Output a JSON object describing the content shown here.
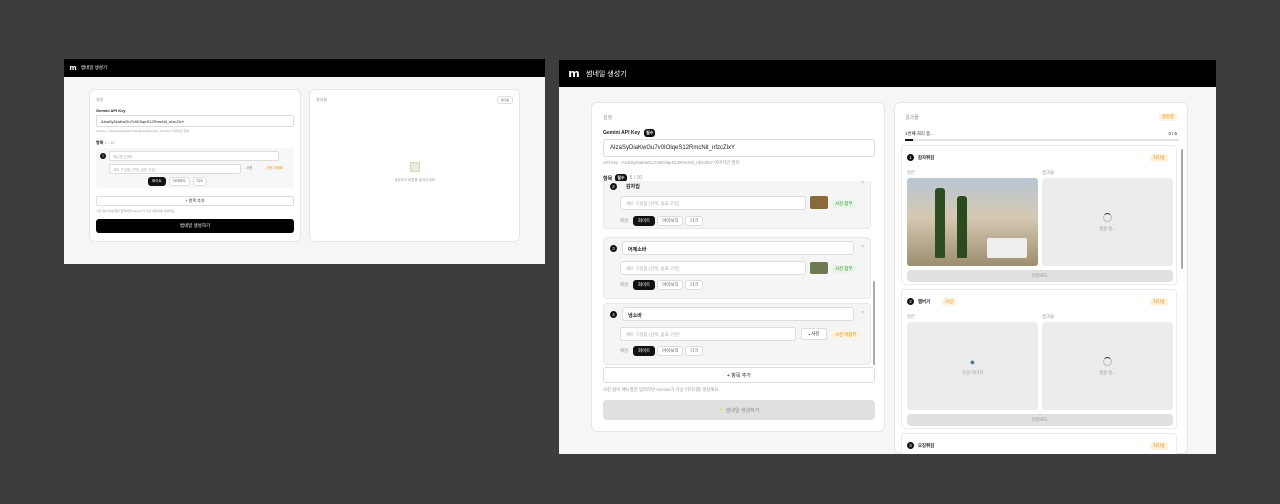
{
  "app": {
    "logo": "m",
    "title": "썸네일 생성기"
  },
  "settings": {
    "title": "설정",
    "api_label": "Gemini API Key",
    "required": "필수",
    "api_value": "AIzaSyDiaKwGu7v0IOlqeS12RmcNit_nfzcZlxY",
    "api_hint": "API key : AIzaSyDiaKwGu7v0IOlqeS12RmcNit_nfzcZlxY 이미지만 많이",
    "items_label": "항목",
    "items_count": "5 / 10",
    "items": [
      {
        "num": "3",
        "name": "어제소바",
        "placeholder": "세트 구성품 (선택, 쉼표 구분)",
        "attach": "사진 첨부",
        "themes": [
          "화이트",
          "아이보리",
          "다크"
        ]
      },
      {
        "num": "4",
        "name": "냉소바",
        "placeholder": "세트 구성품 (선택, 쉼표 구분)",
        "attach_btn": "사진",
        "attach": "사진 미첨부",
        "themes": [
          "화이트",
          "아이보리",
          "다크"
        ]
      }
    ],
    "top_item_name": "감자칩",
    "top_placeholder": "세트 구성품 (선택, 쉼표 구분)",
    "top_attach": "사진 첨부",
    "theme_label": "배경",
    "add_item": "+ 항목 추가",
    "footnote": "사진 없이 메뉴명만 입력하면 Gemini가 가상 이미지를 생성해요",
    "generate": "썸네일 생성하기"
  },
  "results": {
    "title": "결과물",
    "status_badge": "생성중",
    "progress_text": "1번째 처리 중...",
    "progress_count": "0 / 6",
    "progress_pct": 0.03,
    "entries": [
      {
        "num": "1",
        "name": "감자튀김",
        "status": "처리중",
        "left_label": "원본",
        "right_label": "결과물",
        "right_text": "생성 중...",
        "download": "다운로드"
      },
      {
        "num": "2",
        "name": "햄버거",
        "tag": "가상",
        "status": "처리중",
        "left_label": "원본",
        "left_text": "가상 이미지",
        "right_label": "결과물",
        "right_text": "생성 중...",
        "download": "다운로드"
      },
      {
        "num": "3",
        "name": "오징튀김",
        "status": "처리중"
      }
    ]
  },
  "small": {
    "title": "썸네일 생성기",
    "settings_title": "설정",
    "api_label": "Gemini API Key",
    "api_value": "AIzaSyDiaKwGu7v0IOlqeS12RmcNit_nfzcZlxY",
    "api_hint": "API key : AIzaSyDiaKwGu7v0IOlqeS12RmcNit_nfzcZlxY 이미지만 많이",
    "items_label": "항목",
    "items_count": "1 / 10",
    "item_placeholder": "메뉴명 (선택)",
    "set_placeholder": "세트 구성품 (선택, 쉼표 구분)",
    "photo_btn": "사진",
    "photo_tag": "사진 미첨부",
    "themes": [
      "화이트",
      "아이보리",
      "다크"
    ],
    "add_item": "+ 항목 추가",
    "footnote": "사진 없이 메뉴명만 입력하면 Gemini가 가상 이미지를 생성해요",
    "generate": "썸네일 생성하기",
    "results_title": "결과물",
    "results_badge": "대기중",
    "empty_text": "생성하기 버튼을 눌러주세요"
  }
}
